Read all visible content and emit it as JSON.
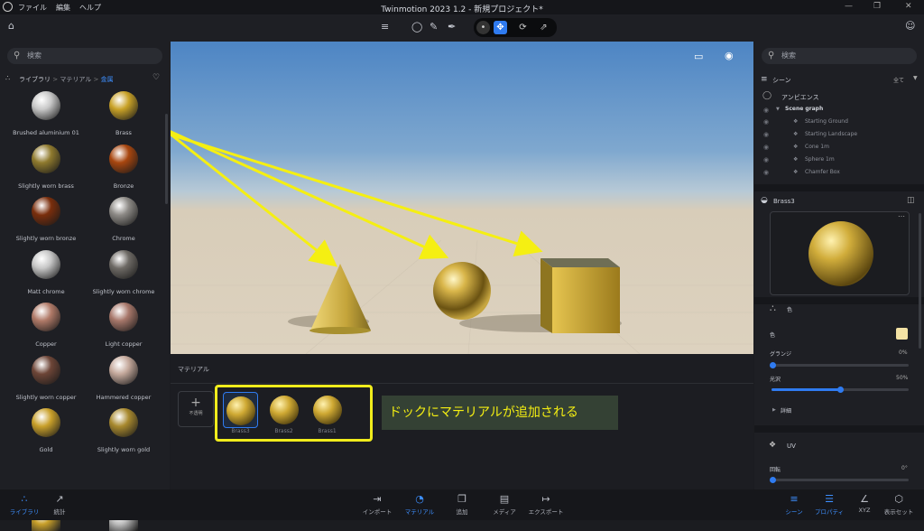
{
  "titlebar": {
    "menu": [
      "ファイル",
      "編集",
      "ヘルプ"
    ],
    "title": "Twinmotion 2023 1.2 - 新規プロジェクト*"
  },
  "toolbar": {
    "icons": [
      "home-icon",
      "layers-icon",
      "materials-icon",
      "paint-icon",
      "orbit-icon",
      "move-icon",
      "rotate-icon",
      "scale-icon",
      "user-icon"
    ]
  },
  "left": {
    "search_placeholder": "検索",
    "breadcrumb": {
      "root": "ライブラリ",
      "sep1": ">",
      "mid": "マテリアル",
      "sep2": ">",
      "current": "金属"
    },
    "materials": [
      {
        "label": "Brushed aluminium 01",
        "color": "#c8c8c8"
      },
      {
        "label": "Brass",
        "color": "#c9a227"
      },
      {
        "label": "Slightly worn brass",
        "color": "#8f7a2e"
      },
      {
        "label": "Bronze",
        "color": "#a8460f"
      },
      {
        "label": "Slightly worn bronze",
        "color": "#7a2e0c"
      },
      {
        "label": "Chrome",
        "color": "#8d8a86"
      },
      {
        "label": "Matt chrome",
        "color": "#c6c6c6"
      },
      {
        "label": "Slightly worn chrome",
        "color": "#6e6a65"
      },
      {
        "label": "Copper",
        "color": "#b07a68"
      },
      {
        "label": "Light copper",
        "color": "#a7776a"
      },
      {
        "label": "Slightly worn copper",
        "color": "#6d4537"
      },
      {
        "label": "Hammered copper",
        "color": "#c5a99c"
      },
      {
        "label": "Gold",
        "color": "#c9a02a"
      },
      {
        "label": "Slightly worn gold",
        "color": "#a8892e"
      }
    ]
  },
  "dock": {
    "label": "マテリアル",
    "add_label": "不透明",
    "items": [
      "Brass3",
      "Brass2",
      "Brass1"
    ],
    "annotation": "ドックにマテリアルが追加される"
  },
  "right": {
    "search_placeholder": "検索",
    "scene_title": "シーン",
    "filter": "全て",
    "ambience": "アンビエンス",
    "scene_graph": "Scene graph",
    "tree": [
      "Starting Ground",
      "Starting Landscape",
      "Cone 1m",
      "Sphere 1m",
      "Chamfer Box"
    ],
    "material_name": "Brass3",
    "color_label": "色",
    "grunge_label": "グランジ",
    "grunge_value": "0%",
    "grunge": 0,
    "gloss_label": "光沢",
    "gloss_value": "50%",
    "gloss": 50,
    "details_label": "詳細",
    "uv_label": "UV",
    "rotation_label": "回転",
    "rotation_value": "0°",
    "swatch_color": "#f3e2a4"
  },
  "bottombar": {
    "left": [
      {
        "label": "ライブラリ",
        "icon": "library-icon",
        "active": true
      },
      {
        "label": "統計",
        "icon": "stats-icon",
        "active": false
      }
    ],
    "center": [
      {
        "label": "インポート",
        "icon": "import-icon"
      },
      {
        "label": "マテリアル",
        "icon": "material-icon",
        "active": true
      },
      {
        "label": "追加",
        "icon": "add-icon"
      },
      {
        "label": "メディア",
        "icon": "media-icon"
      },
      {
        "label": "エクスポート",
        "icon": "export-icon"
      }
    ],
    "right": [
      {
        "label": "シーン",
        "icon": "scene-icon",
        "active": true
      },
      {
        "label": "プロパティ",
        "icon": "properties-icon",
        "active": true
      },
      {
        "label": "XYZ",
        "icon": "xyz-icon"
      },
      {
        "label": "表示セット",
        "icon": "view-set-icon"
      }
    ]
  }
}
